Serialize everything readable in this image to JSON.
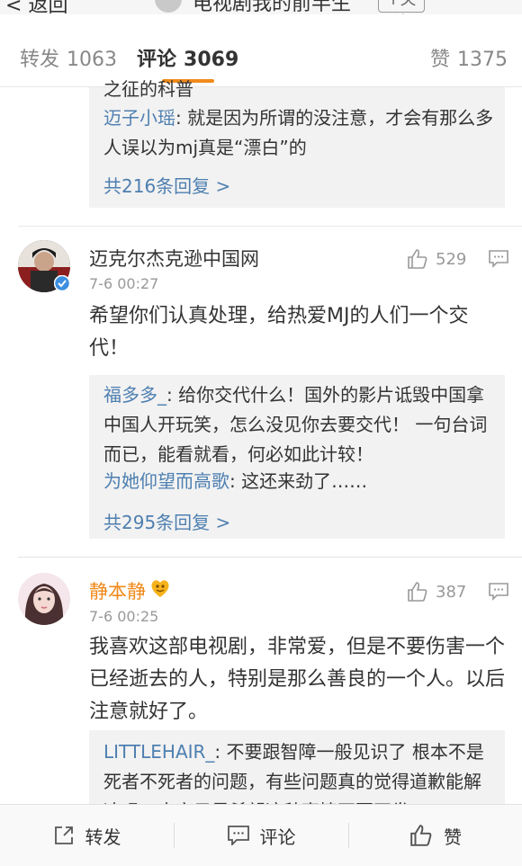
{
  "header": {
    "back_label": "返回",
    "account_name": "电视剧我的前半生",
    "follow_label": "+关注"
  },
  "tabs": [
    {
      "label": "转发",
      "count": "1063"
    },
    {
      "label": "评论",
      "count": "3069"
    },
    {
      "label": "赞",
      "count": "1375"
    }
  ],
  "thread_top": {
    "partial_line": "之征的科普",
    "replies": [
      {
        "user": "迈子小瑶",
        "text": ": 就是因为所谓的没注意，才会有那么多人误以为mj真是“漂白”的"
      }
    ],
    "more_label": "共216条回复 >"
  },
  "comments": [
    {
      "user": "迈克尔杰克逊中国网",
      "time": "7-6 00:27",
      "likes": "529",
      "text": "希望你们认真处理，给热爱MJ的人们一个交代！",
      "replies": [
        {
          "user": "福多多_",
          "text": ": 给你交代什么！国外的影片诋毁中国拿中国人开玩笑，怎么没见你去要交代！ 一句台词而已，能看就看，何必如此计较！"
        },
        {
          "user": "为她仰望而高歌",
          "text": ": 这还来劲了……"
        }
      ],
      "more_label": "共295条回复 >"
    },
    {
      "user": "静本静",
      "time": "7-6 00:25",
      "likes": "387",
      "text": "我喜欢这部电视剧，非常爱，但是不要伤害一个已经逝去的人，特别是那么善良的一个人。以后注意就好了。",
      "replies": [
        {
          "user": "LITTLEHAIR_",
          "text": ": 不要跟智障一般见识了 根本不是死者不死者的问题，有些问题真的觉得道歉能解决吗，大家只是希望这种事情不要再发"
        }
      ]
    }
  ],
  "bottom_bar": {
    "repost_label": "转发",
    "comment_label": "评论",
    "like_label": "赞"
  },
  "colors": {
    "accent": "#f08a1b",
    "link": "#4e7fb0",
    "verified": "#3b8fe0"
  }
}
